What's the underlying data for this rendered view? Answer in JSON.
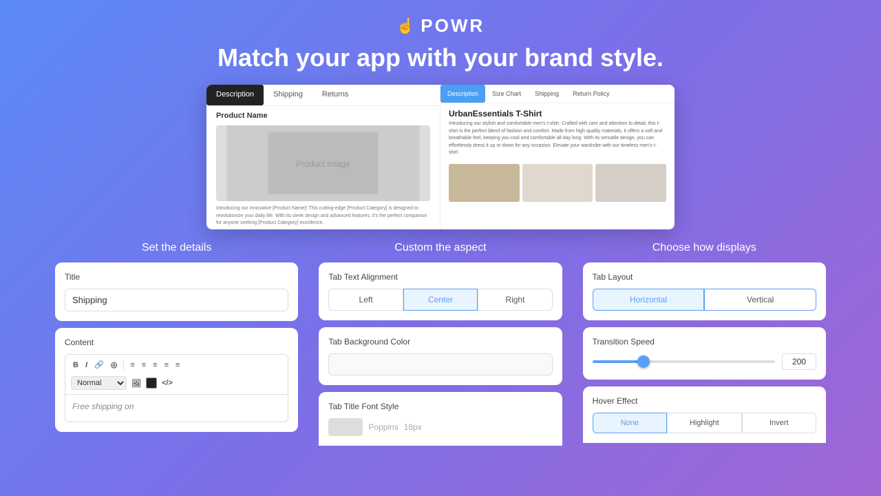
{
  "header": {
    "logo_icon": "☝",
    "logo_text": "POWR",
    "tagline": "Match your app with your brand style."
  },
  "preview": {
    "left_tabs": [
      "Description",
      "Shipping",
      "Returns"
    ],
    "left_active_tab": "Description",
    "left_product_name": "Product Name",
    "left_description": "Introducing our innovative [Product Name]! This cutting-edge [Product Category] is designed to revolutionize your daily life. With its sleek design and advanced features, it's the perfect companion for anyone seeking [Product Category] excellence. Whether you're a beginner or an expert, [Product Name] is here to elevate your experience to new heights.",
    "right_tabs": [
      "Description",
      "Size Chart",
      "Shipping",
      "Return Policy"
    ],
    "right_active_tab": "Description",
    "right_product_title": "UrbanEssentials T-Shirt",
    "right_desc": "Introducing our stylish and comfortable men's t-shirt. Crafted with care and attention to detail, this t-shirt is the perfect blend of fashion and comfort. Made from high quality materials, it offers a soft and breathable feel, keeping you cool and comfortable all day long. With its versatile design, you can effortlessly dress it up or down for any occasion. Elevate your wardrobe with our timeless men's t-shirt."
  },
  "columns": {
    "col1_title": "Set the details",
    "col2_title": "Custom the aspect",
    "col3_title": "Choose how displays"
  },
  "details": {
    "title_label": "Title",
    "title_value": "Shipping",
    "content_label": "Content",
    "editor_buttons": [
      "B",
      "I",
      "🔗",
      "◎",
      "≡",
      "≡",
      "≡",
      "≡",
      "≡"
    ],
    "style_select": "Normal",
    "editor_text": "Free shipping on"
  },
  "aspect": {
    "alignment_label": "Tab Text Alignment",
    "alignment_options": [
      "Left",
      "Center",
      "Right"
    ],
    "alignment_active": "Center",
    "bg_color_label": "Tab Background Color",
    "bg_color_value": "",
    "font_style_label": "Tab Title Font Style"
  },
  "display": {
    "layout_label": "Tab Layout",
    "layout_options": [
      "Horizontal",
      "Vertical"
    ],
    "layout_active": "Horizontal",
    "speed_label": "Transition Speed",
    "speed_value": "200",
    "hover_label": "Hover Effect",
    "hover_options": [
      "None",
      "Highlight",
      "Invert"
    ],
    "hover_active": "None"
  }
}
